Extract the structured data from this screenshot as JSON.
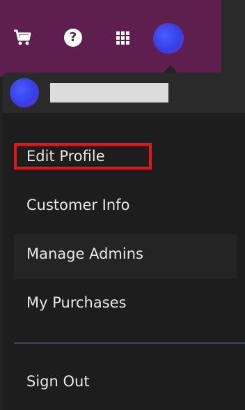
{
  "header": {
    "icons": [
      "cart-icon",
      "help-icon",
      "apps-grid-icon",
      "avatar"
    ],
    "help_glyph": "?",
    "background_color": "#5e1f4e"
  },
  "user_menu": {
    "items": [
      {
        "label": "Edit Profile"
      },
      {
        "label": "Customer Info"
      },
      {
        "label": "Manage Admins"
      },
      {
        "label": "My Purchases"
      },
      {
        "label": "Sign Out"
      }
    ],
    "focus_color": "#e3141c"
  }
}
